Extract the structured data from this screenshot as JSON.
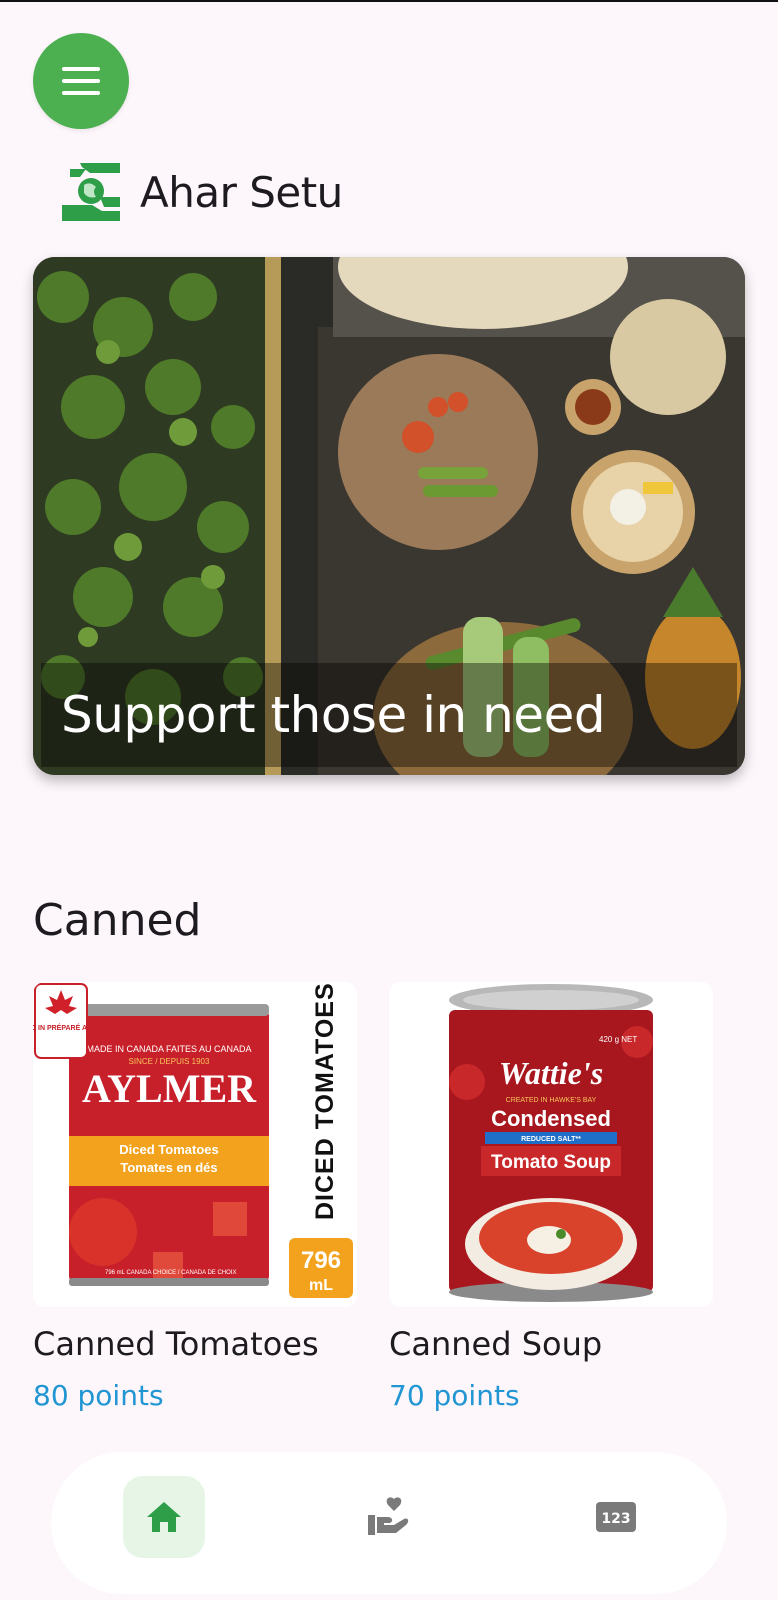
{
  "app": {
    "title": "Ahar Setu"
  },
  "hero": {
    "caption": "Support those in need"
  },
  "section": {
    "title": "Canned"
  },
  "products": [
    {
      "name": "Canned Tomatoes",
      "points": "80 points",
      "label": {
        "badge": "PREPARED IN PRÉPARÉ AU CANADA",
        "origin": "MADE IN CANADA  FAITES AU CANADA",
        "since": "SINCE / DEPUIS 1903",
        "brand": "AYLMER",
        "desc_line1": "Diced Tomatoes",
        "desc_line2": "Tomates en dés",
        "side_text": "DICED TOMATOES",
        "volume": "796",
        "unit": "mL",
        "fine": "796 mL   CANADA CHOICE / CANADA DE CHOIX"
      }
    },
    {
      "name": "Canned Soup",
      "points": "70 points",
      "label": {
        "weight": "420 g NET",
        "brand": "Wattie's",
        "origin": "CREATED IN HAWKE'S BAY",
        "line1": "Condensed",
        "line2": "REDUCED SALT**",
        "line3": "Tomato Soup"
      }
    }
  ],
  "nav": {
    "items": [
      {
        "icon": "home-icon",
        "active": true
      },
      {
        "icon": "donate-hand-heart-icon",
        "active": false
      },
      {
        "icon": "numbers-123-icon",
        "active": false,
        "text": "123"
      }
    ]
  },
  "colors": {
    "primary_green": "#4caf50",
    "link_blue": "#2196d3",
    "background": "#fdf6fb"
  }
}
